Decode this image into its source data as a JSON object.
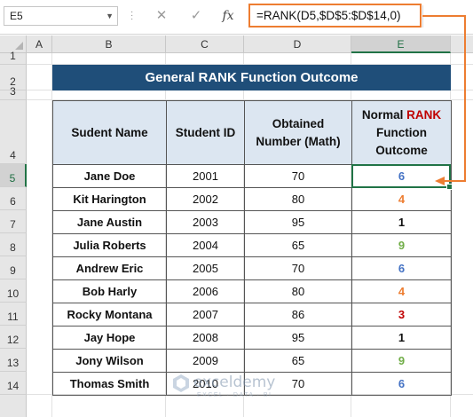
{
  "formula_bar": {
    "name_box": "E5",
    "cancel_icon": "✕",
    "enter_icon": "✓",
    "fx_label": "fx",
    "formula": "=RANK(D5,$D$5:$D$14,0)"
  },
  "columns": [
    "A",
    "B",
    "C",
    "D",
    "E"
  ],
  "rows": [
    "1",
    "2",
    "3",
    "4",
    "5",
    "6",
    "7",
    "8",
    "9",
    "10",
    "11",
    "12",
    "13",
    "14"
  ],
  "selected_cell": {
    "column": "E",
    "row": "5"
  },
  "title": "General RANK Function Outcome",
  "table": {
    "headers": {
      "name": "Sudent Name",
      "id": "Student ID",
      "obtained_1": "Obtained",
      "obtained_2": "Number (Math)",
      "rank_1a": "Normal ",
      "rank_1b": "RANK",
      "rank_2": "Function",
      "rank_3": "Outcome"
    },
    "rows": [
      {
        "name": "Jane Doe",
        "id": "2001",
        "number": "70",
        "rank": "6",
        "rank_color": "#4472c4"
      },
      {
        "name": "Kit Harington",
        "id": "2002",
        "number": "80",
        "rank": "4",
        "rank_color": "#ed7d31"
      },
      {
        "name": "Jane Austin",
        "id": "2003",
        "number": "95",
        "rank": "1",
        "rank_color": "#111111"
      },
      {
        "name": "Julia Roberts",
        "id": "2004",
        "number": "65",
        "rank": "9",
        "rank_color": "#70ad47"
      },
      {
        "name": "Andrew Eric",
        "id": "2005",
        "number": "70",
        "rank": "6",
        "rank_color": "#4472c4"
      },
      {
        "name": "Bob Harly",
        "id": "2006",
        "number": "80",
        "rank": "4",
        "rank_color": "#ed7d31"
      },
      {
        "name": "Rocky Montana",
        "id": "2007",
        "number": "86",
        "rank": "3",
        "rank_color": "#c00000"
      },
      {
        "name": "Jay Hope",
        "id": "2008",
        "number": "95",
        "rank": "1",
        "rank_color": "#111111"
      },
      {
        "name": "Jony Wilson",
        "id": "2009",
        "number": "65",
        "rank": "9",
        "rank_color": "#70ad47"
      },
      {
        "name": "Thomas Smith",
        "id": "2010",
        "number": "70",
        "rank": "6",
        "rank_color": "#4472c4"
      }
    ]
  },
  "watermark": {
    "brand": "exceldemy",
    "tagline": "EXCEL · DATA · BI"
  },
  "colors": {
    "banner": "#1f4e79",
    "header_fill": "#dce6f1",
    "accent": "#ed7d31",
    "selection": "#217346"
  }
}
